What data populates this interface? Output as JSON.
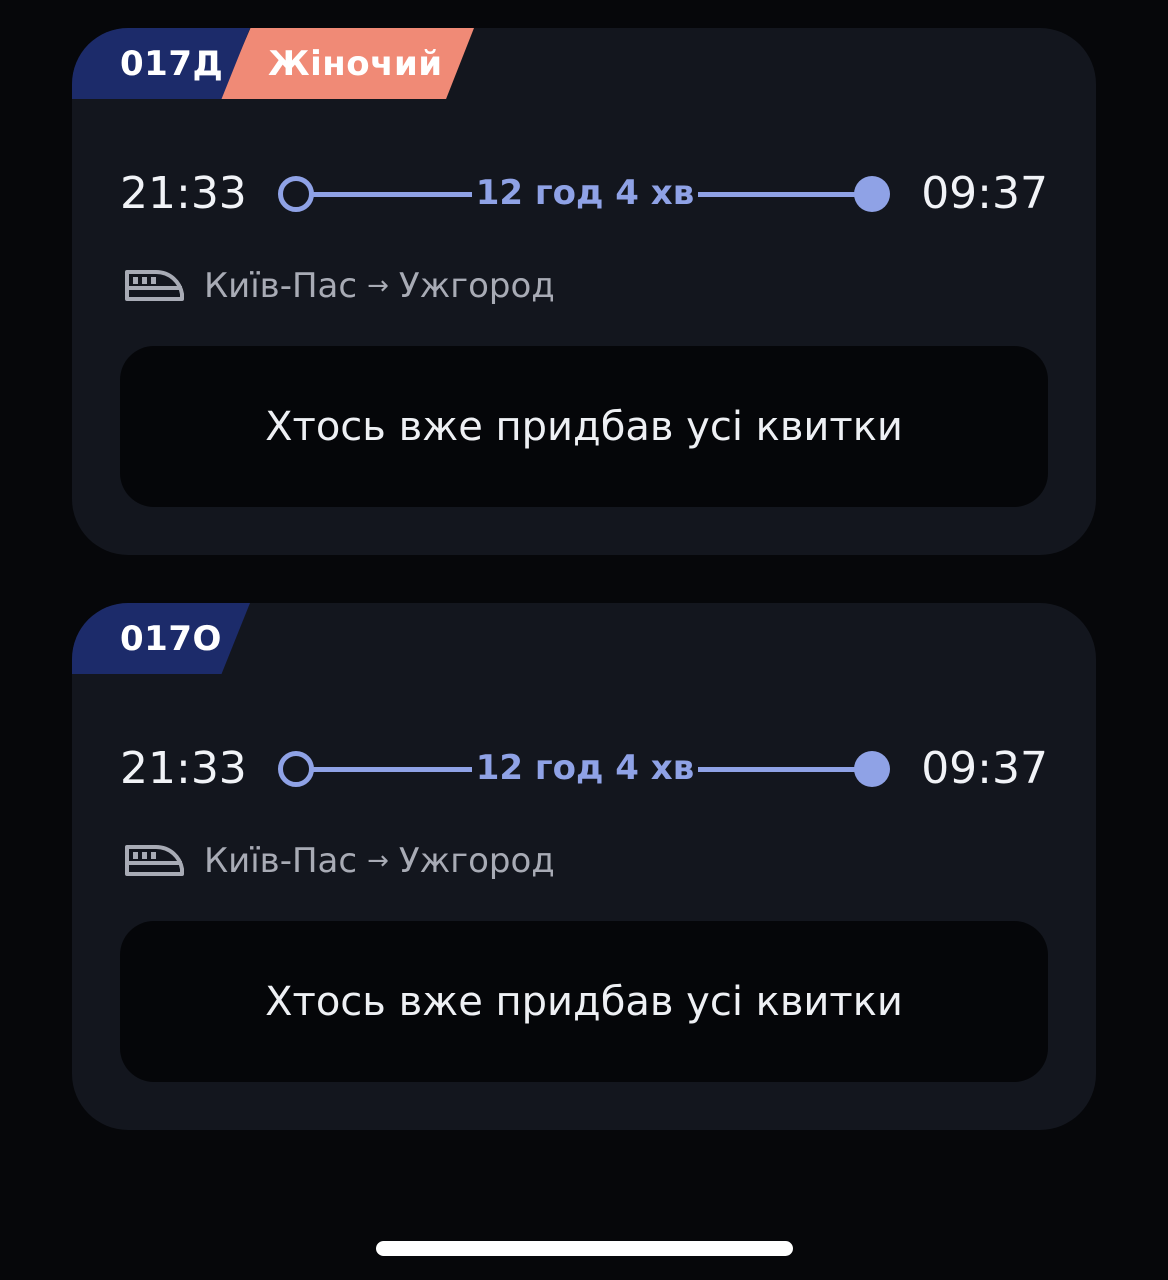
{
  "trains": [
    {
      "number": "017Д",
      "type_badge": "Жіночий",
      "departure": "21:33",
      "duration": "12 год 4 хв",
      "arrival": "09:37",
      "from": "Київ-Пас",
      "arrow": "→",
      "to": "Ужгород",
      "status": "Хтось вже придбав усі квитки"
    },
    {
      "number": "017О",
      "departure": "21:33",
      "duration": "12 год 4 хв",
      "arrival": "09:37",
      "from": "Київ-Пас",
      "arrow": "→",
      "to": "Ужгород",
      "status": "Хтось вже придбав усі квитки"
    }
  ],
  "icons": {
    "train": "train-icon"
  },
  "colors": {
    "background": "#06070a",
    "card": "#13161e",
    "number_badge": "#1c2b6a",
    "women_badge": "#f08a76",
    "accent": "#8fa2e6",
    "sold_box": "#050609"
  }
}
